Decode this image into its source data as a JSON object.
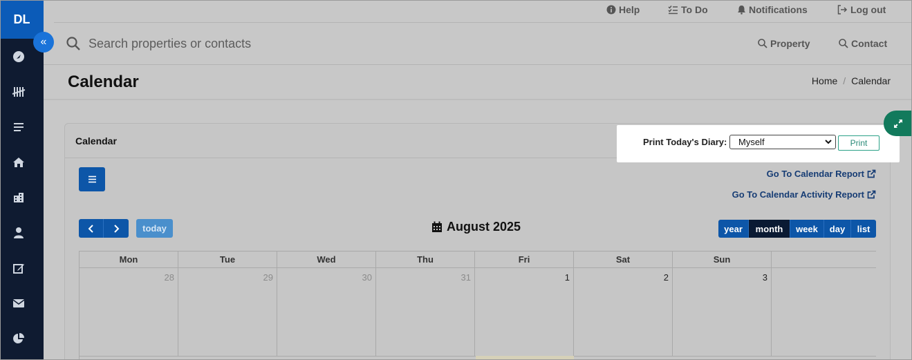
{
  "sidebar": {
    "logo": "DL",
    "items": [
      {
        "icon": "dashboard-icon"
      },
      {
        "icon": "tally-icon"
      },
      {
        "icon": "list-icon"
      },
      {
        "icon": "home-icon"
      },
      {
        "icon": "building-icon"
      },
      {
        "icon": "person-icon"
      },
      {
        "icon": "edit-icon"
      },
      {
        "icon": "mail-icon"
      },
      {
        "icon": "pie-chart-icon"
      }
    ]
  },
  "topbar": {
    "help": "Help",
    "todo": "To Do",
    "notifications": "Notifications",
    "logout": "Log out"
  },
  "search": {
    "placeholder": "Search properties or contacts",
    "property": "Property",
    "contact": "Contact"
  },
  "page": {
    "title": "Calendar",
    "breadcrumb": [
      "Home",
      "Calendar"
    ]
  },
  "card": {
    "title": "Calendar",
    "print_label": "Print Today's Diary:",
    "print_select": "Myself",
    "print_button": "Print",
    "report_link": "Go To Calendar Report",
    "activity_link": "Go To Calendar Activity Report"
  },
  "calendar": {
    "title": "August 2025",
    "today_label": "today",
    "views": [
      "year",
      "month",
      "week",
      "day",
      "list"
    ],
    "active_view": "month",
    "days_of_week": [
      "Mon",
      "Tue",
      "Wed",
      "Thu",
      "Fri",
      "Sat",
      "Sun"
    ],
    "first_week": [
      {
        "num": "28",
        "other": true
      },
      {
        "num": "29",
        "other": true
      },
      {
        "num": "30",
        "other": true
      },
      {
        "num": "31",
        "other": true
      },
      {
        "num": "1",
        "other": false
      },
      {
        "num": "2",
        "other": false
      },
      {
        "num": "3",
        "other": false
      }
    ]
  },
  "colors": {
    "sidebar_bg": "#0f1b31",
    "primary": "#0d56a8",
    "active_view": "#0a1a33",
    "expand_tab": "#127a5c"
  }
}
